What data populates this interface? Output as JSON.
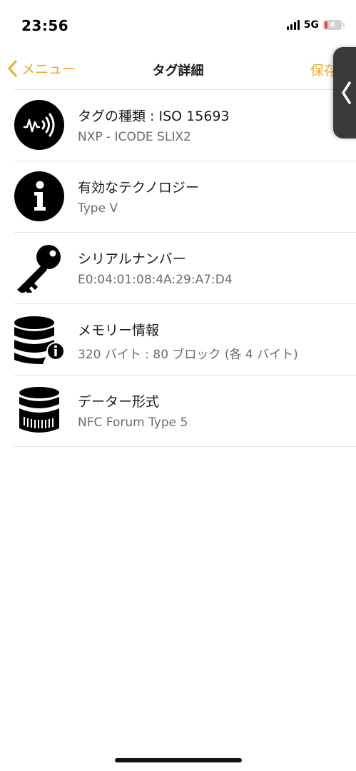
{
  "status_bar": {
    "time": "23:56",
    "network": "5G",
    "battery": "6"
  },
  "nav": {
    "back_label": "メニュー",
    "title": "タグ詳細",
    "save_label": "保存"
  },
  "rows": [
    {
      "icon": "nfc-icon",
      "title": "タグの種類 : ISO 15693",
      "subtitle": "NXP - ICODE SLIX2"
    },
    {
      "icon": "info-icon",
      "title": "有効なテクノロジー",
      "subtitle": "Type V"
    },
    {
      "icon": "key-icon",
      "title": "シリアルナンバー",
      "subtitle": "E0:04:01:08:4A:29:A7:D4"
    },
    {
      "icon": "database-info-icon",
      "title": "メモリー情報",
      "subtitle": "320 バイト : 80 ブロック (各 4 バイト)"
    },
    {
      "icon": "database-icon",
      "title": "データー形式",
      "subtitle": "NFC Forum Type 5"
    }
  ],
  "colors": {
    "accent": "#f5a623",
    "text": "#1c1c1e",
    "subtext": "#6b6b70",
    "divider": "#e3e3e6"
  }
}
